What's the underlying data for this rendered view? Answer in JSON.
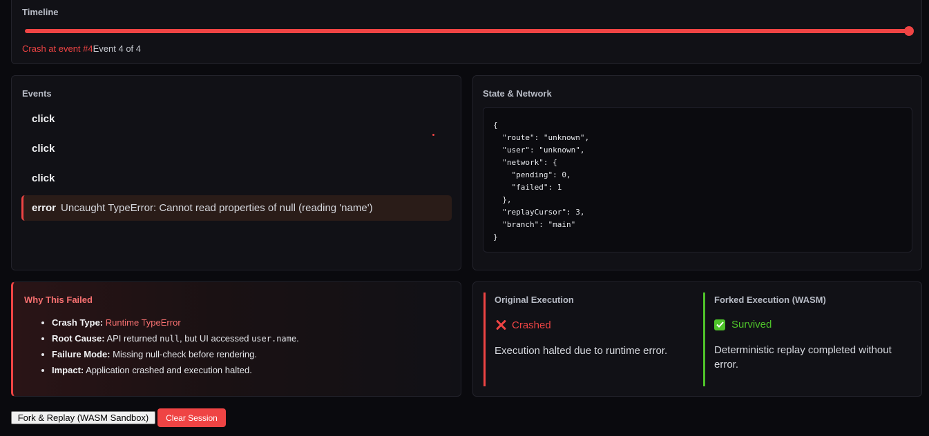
{
  "timeline": {
    "title": "Timeline",
    "progress": 1.0,
    "crash_label": "Crash at event #4",
    "event_count": "Event 4 of 4"
  },
  "events": {
    "title": "Events",
    "items": [
      {
        "type": "click",
        "message": ""
      },
      {
        "type": "click",
        "message": ""
      },
      {
        "type": "click",
        "message": ""
      },
      {
        "type": "error",
        "message": "Uncaught TypeError: Cannot read properties of null (reading 'name')"
      }
    ]
  },
  "state": {
    "title": "State & Network",
    "json": "{\n  \"route\": \"unknown\",\n  \"user\": \"unknown\",\n  \"network\": {\n    \"pending\": 0,\n    \"failed\": 1\n  },\n  \"replayCursor\": 3,\n  \"branch\": \"main\"\n}"
  },
  "why": {
    "title": "Why This Failed",
    "crash_type_label": "Crash Type:",
    "crash_type_value": "Runtime TypeError",
    "root_cause_label": "Root Cause:",
    "root_cause_pre": "API returned",
    "root_cause_code1": "null",
    "root_cause_mid": ", but UI accessed",
    "root_cause_code2": "user.name",
    "root_cause_post": ".",
    "failure_mode_label": "Failure Mode:",
    "failure_mode_value": "Missing null-check before rendering.",
    "impact_label": "Impact:",
    "impact_value": "Application crashed and execution halted."
  },
  "compare": {
    "original": {
      "title": "Original Execution",
      "status": "Crashed",
      "icon": "x-icon",
      "description": "Execution halted due to runtime error."
    },
    "forked": {
      "title": "Forked Execution (WASM)",
      "status": "Survived",
      "icon": "check-icon",
      "description": "Deterministic replay completed without error."
    }
  },
  "buttons": {
    "fork": "Fork & Replay (WASM Sandbox)",
    "clear": "Clear Session"
  },
  "colors": {
    "accent_red": "#ef4444",
    "success_green": "#4ec22a",
    "background": "#0a0a0e"
  }
}
